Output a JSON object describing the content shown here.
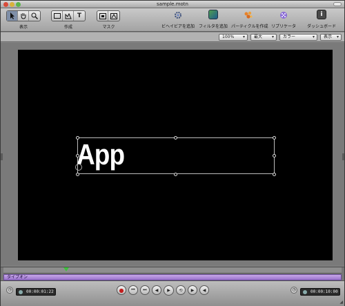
{
  "window": {
    "title": "sample.motn"
  },
  "toolbar": {
    "groups": [
      {
        "label": "表示",
        "tools": [
          "selector-arrow-icon",
          "hand-icon",
          "zoom-icon"
        ]
      },
      {
        "label": "作成",
        "tools": [
          "rectangle-icon",
          "bezier-icon",
          "text-icon"
        ]
      },
      {
        "label": "マスク",
        "tools": [
          "mask-rectangle-icon",
          "mask-bezier-icon"
        ]
      }
    ],
    "buttons": [
      {
        "label": "ビヘイビアを追加",
        "icon": "behavior-gear-icon"
      },
      {
        "label": "フィルタを追加",
        "icon": "filter-icon"
      },
      {
        "label": "パーティクルを作成",
        "icon": "particle-icon"
      },
      {
        "label": "リプリケータ",
        "icon": "replicator-icon"
      },
      {
        "label": "ダッシュボード",
        "icon": "dashboard-icon"
      }
    ]
  },
  "options": {
    "zoom": "100%",
    "quality": "最大",
    "channel": "カラー",
    "view": "表示"
  },
  "canvas": {
    "text": "App",
    "background_color": "#000000"
  },
  "timeline": {
    "track_label": "タイプオン"
  },
  "transport": {
    "current_time": "00:00:01:22",
    "duration": "00:00:10:00"
  }
}
